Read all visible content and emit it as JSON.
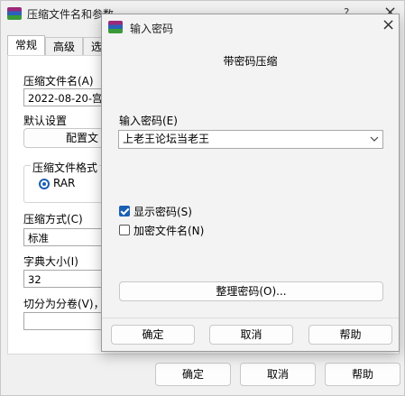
{
  "back_window": {
    "title": "压缩文件名和参数",
    "help_glyph": "?",
    "close_glyph": "×",
    "tabs": [
      "常规",
      "高级",
      "选"
    ],
    "archive_name_label": "压缩文件名(A)",
    "archive_name_value": "2022-08-20-宫廷",
    "default_settings_label": "默认设置",
    "profiles_button": "配置文",
    "format_group_label": "压缩文件格式",
    "format_rar": "RAR",
    "method_label": "压缩方式(C)",
    "method_value": "标准",
    "dict_label": "字典大小(I)",
    "dict_value": "32",
    "split_label": "切分为分卷(V)，",
    "ok": "确定",
    "cancel": "取消",
    "help": "帮助"
  },
  "dialog": {
    "title": "输入密码",
    "close_glyph": "×",
    "heading": "带密码压缩",
    "password_label": "输入密码(E)",
    "password_value": "上老王论坛当老王",
    "show_password_label": "显示密码(S)",
    "show_password_checked": true,
    "encrypt_names_label": "加密文件名(N)",
    "encrypt_names_checked": false,
    "organize_button": "整理密码(O)...",
    "ok": "确定",
    "cancel": "取消",
    "help": "帮助"
  },
  "colors": {
    "accent": "#1a5fb4",
    "window_bg": "#f0f0f0"
  }
}
